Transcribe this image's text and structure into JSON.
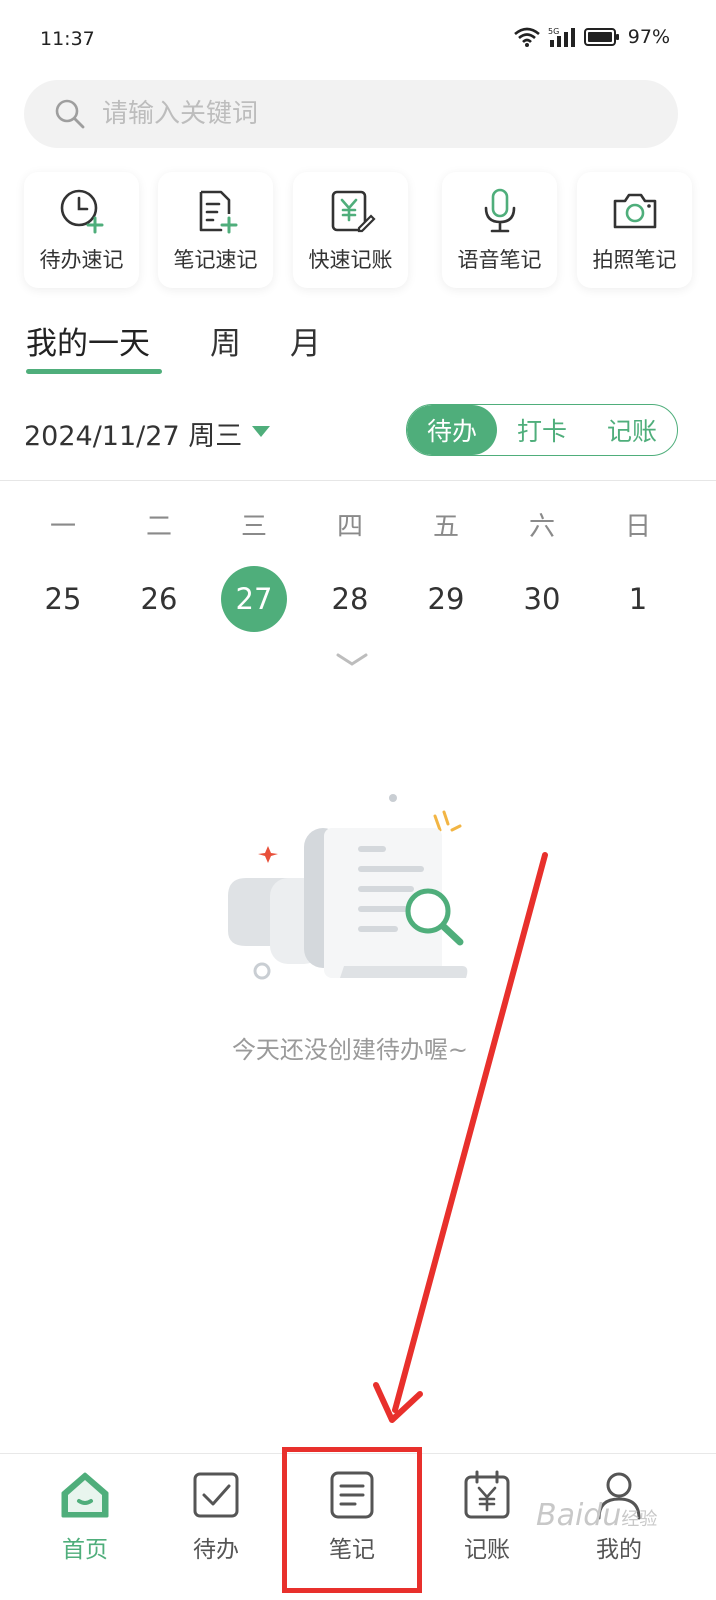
{
  "status": {
    "time": "11:37",
    "network": "5G",
    "battery": "97%"
  },
  "search": {
    "placeholder": "请输入关键词"
  },
  "quick_actions": [
    {
      "label": "待办速记",
      "icon": "clock-plus-icon"
    },
    {
      "label": "笔记速记",
      "icon": "note-plus-icon"
    },
    {
      "label": "快速记账",
      "icon": "yen-edit-icon"
    },
    {
      "label": "语音笔记",
      "icon": "microphone-icon"
    },
    {
      "label": "拍照笔记",
      "icon": "camera-icon"
    }
  ],
  "tabs": [
    {
      "label": "我的一天",
      "active": true
    },
    {
      "label": "周",
      "active": false
    },
    {
      "label": "月",
      "active": false
    }
  ],
  "date_selector": {
    "label": "2024/11/27 周三"
  },
  "segment": [
    {
      "label": "待办",
      "active": true
    },
    {
      "label": "打卡",
      "active": false
    },
    {
      "label": "记账",
      "active": false
    }
  ],
  "week": {
    "headers": [
      "一",
      "二",
      "三",
      "四",
      "五",
      "六",
      "日"
    ],
    "days": [
      "25",
      "26",
      "27",
      "28",
      "29",
      "30",
      "1"
    ],
    "today": "27"
  },
  "empty_state": {
    "message": "今天还没创建待办喔~"
  },
  "bottom_nav": [
    {
      "label": "首页",
      "icon": "home-icon",
      "active": true
    },
    {
      "label": "待办",
      "icon": "checkbox-icon",
      "active": false
    },
    {
      "label": "笔记",
      "icon": "document-icon",
      "active": false
    },
    {
      "label": "记账",
      "icon": "calendar-yen-icon",
      "active": false
    },
    {
      "label": "我的",
      "icon": "user-icon",
      "active": false
    }
  ],
  "watermark": {
    "brand": "Baidu",
    "suffix": "经验"
  },
  "colors": {
    "accent": "#4fae7b",
    "annotation": "#e8302c"
  }
}
